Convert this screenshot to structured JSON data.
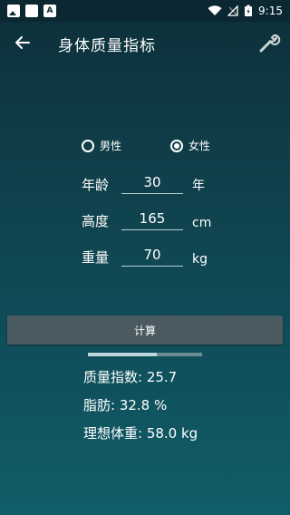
{
  "status_bar": {
    "time": "9:15",
    "left_icons": [
      "image-icon",
      "square-icon",
      "letter-a-icon"
    ],
    "right_icons": [
      "wifi-icon",
      "signal-icon",
      "battery-icon"
    ],
    "a_letter": "A"
  },
  "app_bar": {
    "title": "身体质量指标",
    "back_icon": "arrow-left-icon",
    "settings_icon": "wrench-icon"
  },
  "gender": {
    "male_label": "男性",
    "female_label": "女性",
    "selected": "female"
  },
  "fields": {
    "age": {
      "label": "年龄",
      "value": "30",
      "unit": "年"
    },
    "height": {
      "label": "高度",
      "value": "165",
      "unit": "cm"
    },
    "weight": {
      "label": "重量",
      "value": "70",
      "unit": "kg"
    }
  },
  "calculate_button": "计算",
  "progress": {
    "fraction": 0.6
  },
  "results": {
    "bmi": "质量指数:  25.7",
    "fat": "脂肪:  32.8  %",
    "ideal": "理想体重:  58.0  kg"
  },
  "colors": {
    "background_top": "#0c2f39",
    "background_bottom": "#105e69",
    "button": "#4a5a60",
    "progress_fill": "#bcd7dc",
    "progress_track": "#6b8e96"
  }
}
